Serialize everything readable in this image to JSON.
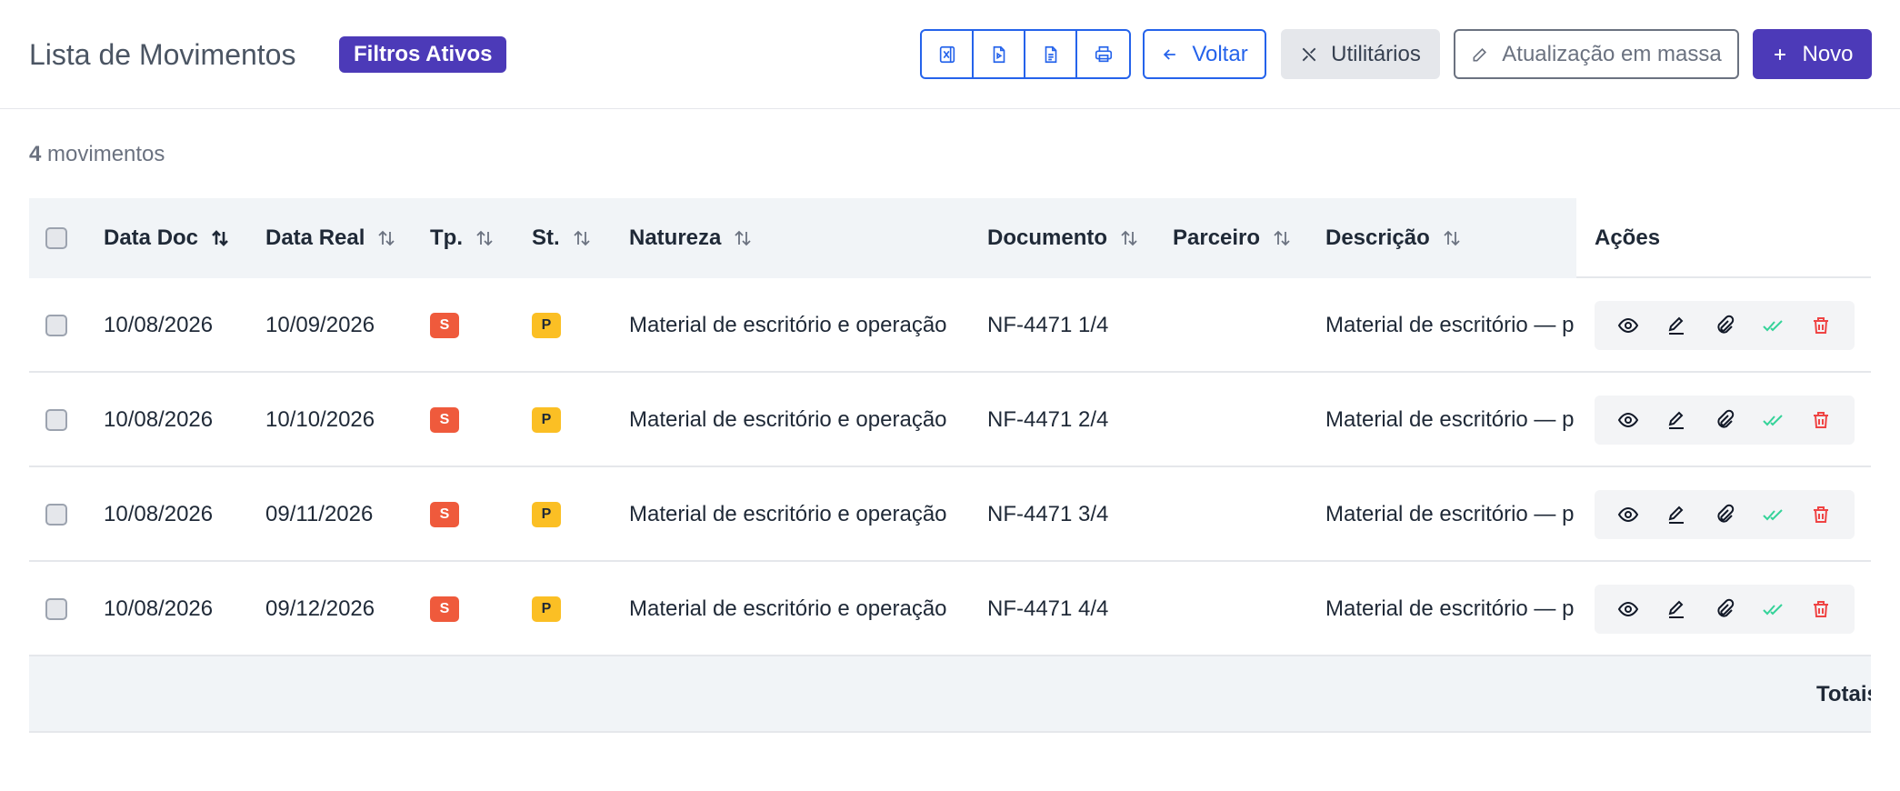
{
  "header": {
    "title": "Lista de Movimentos",
    "filters_badge": "Filtros Ativos",
    "export_buttons": [
      {
        "icon": "excel-icon"
      },
      {
        "icon": "pdf-file-icon"
      },
      {
        "icon": "text-file-icon"
      },
      {
        "icon": "printer-icon"
      }
    ],
    "back_label": "Voltar",
    "utilities_label": "Utilitários",
    "mass_update_label": "Atualização em massa",
    "new_label": "Novo"
  },
  "summary": {
    "count": "4",
    "count_label": "movimentos"
  },
  "table": {
    "columns": {
      "data_doc": "Data Doc",
      "data_real": "Data Real",
      "tipo": "Tp.",
      "status": "St.",
      "natureza": "Natureza",
      "documento": "Documento",
      "parceiro": "Parceiro",
      "descricao": "Descrição",
      "acoes": "Ações"
    },
    "rows": [
      {
        "data_doc": "10/08/2026",
        "data_real": "10/09/2026",
        "tipo": "S",
        "status": "P",
        "natureza": "Material de escritório e operação",
        "documento": "NF-4471 1/4",
        "parceiro": "",
        "descricao": "Material de escritório — p"
      },
      {
        "data_doc": "10/08/2026",
        "data_real": "10/10/2026",
        "tipo": "S",
        "status": "P",
        "natureza": "Material de escritório e operação",
        "documento": "NF-4471 2/4",
        "parceiro": "",
        "descricao": "Material de escritório — p"
      },
      {
        "data_doc": "10/08/2026",
        "data_real": "09/11/2026",
        "tipo": "S",
        "status": "P",
        "natureza": "Material de escritório e operação",
        "documento": "NF-4471 3/4",
        "parceiro": "",
        "descricao": "Material de escritório — p"
      },
      {
        "data_doc": "10/08/2026",
        "data_real": "09/12/2026",
        "tipo": "S",
        "status": "P",
        "natureza": "Material de escritório e operação",
        "documento": "NF-4471 4/4",
        "parceiro": "",
        "descricao": "Material de escritório — p"
      }
    ],
    "footer_totals": "Totais"
  },
  "colors": {
    "primary": "#4c3ab8",
    "link_blue": "#2563eb",
    "tipo_s": "#ef5a3c",
    "status_p": "#fbbf24",
    "approve_green": "#34d399",
    "delete_red": "#ef4444"
  }
}
